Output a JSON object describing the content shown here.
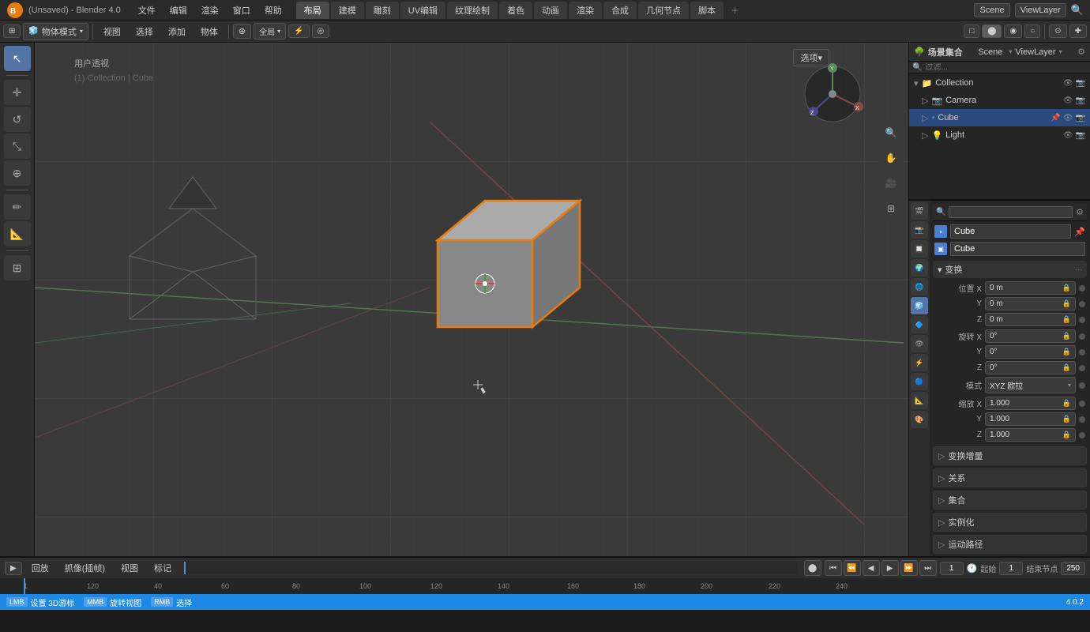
{
  "app": {
    "title": "(Unsaved) - Blender 4.0",
    "version": "4.0.2"
  },
  "topmenu": {
    "title": "(Unsaved) - Blender 4.0",
    "items": [
      "文件",
      "编辑",
      "渲染",
      "窗口",
      "帮助"
    ],
    "workspaces": [
      "布局",
      "建模",
      "雕刻",
      "UV编辑",
      "纹理绘制",
      "着色",
      "动画",
      "渲染",
      "合成",
      "几何节点",
      "脚本"
    ],
    "active_workspace": "布局",
    "plus_label": "＋",
    "scene_label": "Scene",
    "view_layer_label": "ViewLayer"
  },
  "viewport": {
    "header": {
      "mode_label": "物体模式",
      "view_label": "视图",
      "select_label": "选择",
      "add_label": "添加",
      "object_label": "物体",
      "global_label": "全局",
      "overlay_label": "叠加层",
      "shading_labels": [
        "实体",
        "材质",
        "渲染",
        "线框"
      ]
    },
    "overlay_label": "用户透视",
    "collection_label": "(1) Collection | Cube"
  },
  "outliner": {
    "title": "场景集合",
    "items": [
      {
        "name": "Collection",
        "type": "collection",
        "level": 0,
        "expanded": true
      },
      {
        "name": "Camera",
        "type": "camera",
        "level": 1,
        "expanded": false
      },
      {
        "name": "Cube",
        "type": "mesh",
        "level": 1,
        "expanded": false,
        "selected": true
      },
      {
        "name": "Light",
        "type": "light",
        "level": 1,
        "expanded": false
      }
    ]
  },
  "properties": {
    "active_object": "Cube",
    "data_name": "Cube",
    "sections": {
      "transform": {
        "label": "变换",
        "location": {
          "x": "0 m",
          "y": "0 m",
          "z": "0 m"
        },
        "rotation": {
          "x": "0°",
          "y": "0°",
          "z": "0°"
        },
        "rotation_mode": "XYZ 欧拉",
        "scale": {
          "x": "1.000",
          "y": "1.000",
          "z": "1.000"
        }
      },
      "delta_transform": {
        "label": "变换增量"
      },
      "relations": {
        "label": "关系"
      },
      "collections": {
        "label": "集合"
      },
      "instancing": {
        "label": "实例化"
      },
      "motion_path": {
        "label": "运动路径"
      }
    },
    "tabs": [
      {
        "icon": "🎬",
        "label": "render"
      },
      {
        "icon": "📸",
        "label": "output"
      },
      {
        "icon": "🔲",
        "label": "view_layer"
      },
      {
        "icon": "🌍",
        "label": "scene"
      },
      {
        "icon": "🌐",
        "label": "world"
      },
      {
        "icon": "🧊",
        "label": "object",
        "active": true
      },
      {
        "icon": "🔷",
        "label": "modifier"
      },
      {
        "icon": "👁",
        "label": "particles"
      },
      {
        "icon": "⚡",
        "label": "physics"
      },
      {
        "icon": "🔵",
        "label": "constraints"
      },
      {
        "icon": "📐",
        "label": "data"
      },
      {
        "icon": "🎨",
        "label": "material"
      }
    ]
  },
  "timeline": {
    "playback_label": "回放",
    "interpolation_label": "抓像(插帧)",
    "view_label": "视图",
    "marker_label": "标记",
    "frame_current": "1",
    "frame_start": "1",
    "frame_end": "250",
    "start_label": "起始",
    "end_label": "结束节点",
    "playback_btns": [
      "⏮",
      "⏪",
      "◀",
      "▶",
      "⏩",
      "⏭"
    ],
    "keying_btn": "⬤"
  },
  "statusbar": {
    "items": [
      {
        "key": "设置 3D游标",
        "icon": "🖱"
      },
      {
        "key": "旋转视图",
        "icon": "🖱"
      },
      {
        "key": "选择",
        "icon": "🖱"
      }
    ],
    "version": "4.0.2"
  }
}
